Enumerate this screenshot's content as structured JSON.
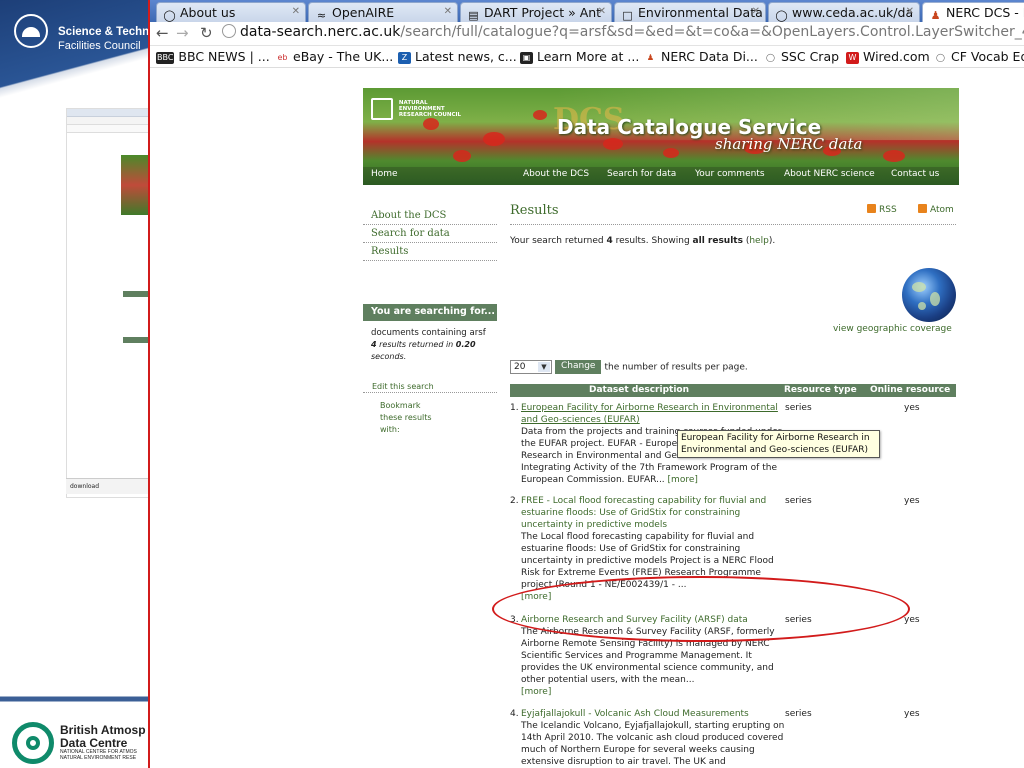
{
  "slide": {
    "org_name_line1": "Science & Techno",
    "org_name_line2": "Facilities Council",
    "download_label": "download",
    "badc_title_line1": "British Atmosp",
    "badc_title_line2": "Data Centre",
    "badc_sub_line1": "NATIONAL CENTRE FOR ATMOS",
    "badc_sub_line2": "NATURAL ENVIRONMENT RESE"
  },
  "browser": {
    "tabs": [
      {
        "label": "About us",
        "icon": "globe-icon"
      },
      {
        "label": "OpenAIRE",
        "icon": "openaire-icon"
      },
      {
        "label": "DART Project » Ant",
        "icon": "document-icon"
      },
      {
        "label": "Environmental Data",
        "icon": "page-icon"
      },
      {
        "label": "www.ceda.ac.uk/da",
        "icon": "globe-icon"
      },
      {
        "label": "NERC DCS - F",
        "icon": "nerc-icon"
      }
    ],
    "address_host": "data-search.nerc.ac.uk",
    "address_path": "/search/full/catalogue?q=arsf&sd=&ed=&t=co&a=&OpenLayers.Control.LayerSwitcher_45_",
    "bookmarks": [
      {
        "label": "BBC NEWS | ...",
        "icon": "bbc-icon"
      },
      {
        "label": "eBay - The UK...",
        "icon": "ebay-icon"
      },
      {
        "label": "Latest news, c...",
        "icon": "news-icon"
      },
      {
        "label": "Learn More at ...",
        "icon": "learn-icon"
      },
      {
        "label": "NERC Data Di...",
        "icon": "nerc-icon"
      },
      {
        "label": "SSC Crap",
        "icon": "globe-icon"
      },
      {
        "label": "Wired.com",
        "icon": "wired-icon"
      },
      {
        "label": "CF Vocab Ed",
        "icon": "globe-icon"
      }
    ]
  },
  "banner": {
    "org_line1": "NATURAL",
    "org_line2": "ENVIRONMENT",
    "org_line3": "RESEARCH COUNCIL",
    "dcs_mark": "DCS",
    "title": "Data Catalogue Service",
    "tagline": "sharing NERC data",
    "nav": [
      "Home",
      "About the DCS",
      "Search for data",
      "Your comments",
      "About NERC science",
      "Contact us"
    ]
  },
  "sidebar": {
    "items": [
      "About the DCS",
      "Search for data",
      "Results"
    ],
    "search_heading": "You are searching for...",
    "search_line1": "documents containing arsf",
    "search_count": "4",
    "search_mid": " results returned in ",
    "search_time": "0.20",
    "search_end": "seconds.",
    "edit_search": "Edit this search",
    "bookmark_line1": "Bookmark",
    "bookmark_line2": "these results",
    "bookmark_line3": "with:"
  },
  "results": {
    "heading": "Results",
    "rss": "RSS",
    "atom": "Atom",
    "summary_pre": "Your search returned ",
    "summary_count": "4",
    "summary_mid": " results. Showing ",
    "summary_all": "all results",
    "summary_help_open": " (",
    "summary_help": "help",
    "summary_help_close": ").",
    "geo_link": "view geographic coverage",
    "per_page_value": "20",
    "change_button": "Change",
    "per_page_text": "the number of results per page.",
    "col_description": "Dataset description",
    "col_type": "Resource type",
    "col_online": "Online resource",
    "tooltip": "European Facility for Airborne Research in Environmental and Geo-sciences (EUFAR)",
    "more_label": "[more]",
    "items": [
      {
        "num": "1.",
        "title": "European Facility for Airborne Research in Environmental and Geo-sciences (EUFAR)",
        "desc": "Data from the projects and training courses funded under the EUFAR project. EUFAR - European Facility for Airborne Research in Environmental and Geo-sciences - is an Integrating Activity of the 7th Framework Program of the European Commission. EUFAR...",
        "type": "series",
        "online": "yes"
      },
      {
        "num": "2.",
        "title": "FREE - Local flood forecasting capability for fluvial and estuarine floods: Use of GridStix for constraining uncertainty in predictive models",
        "desc": "The Local flood forecasting capability for fluvial and estuarine floods: Use of GridStix for constraining uncertainty in predictive models Project is a NERC Flood Risk for Extreme Events (FREE) Research Programme project (Round 1 - NE/E002439/1 - ...",
        "type": "series",
        "online": "yes"
      },
      {
        "num": "3.",
        "title": "Airborne Research and Survey Facility (ARSF) data",
        "desc": "The Airborne Research & Survey Facility (ARSF, formerly Airborne Remote Sensing Facility) is managed by NERC Scientific Services and Programme Management. It provides the UK environmental science community, and other potential users, with the mean...",
        "type": "series",
        "online": "yes"
      },
      {
        "num": "4.",
        "title": "Eyjafjallajokull - Volcanic Ash Cloud Measurements",
        "desc": "The Icelandic Volcano, Eyjafjallajokull, starting erupting on 14th April 2010. The volcanic ash cloud produced covered much of Northern Europe for several weeks causing extensive disruption to air travel. The UK and",
        "type": "series",
        "online": "yes"
      }
    ]
  }
}
